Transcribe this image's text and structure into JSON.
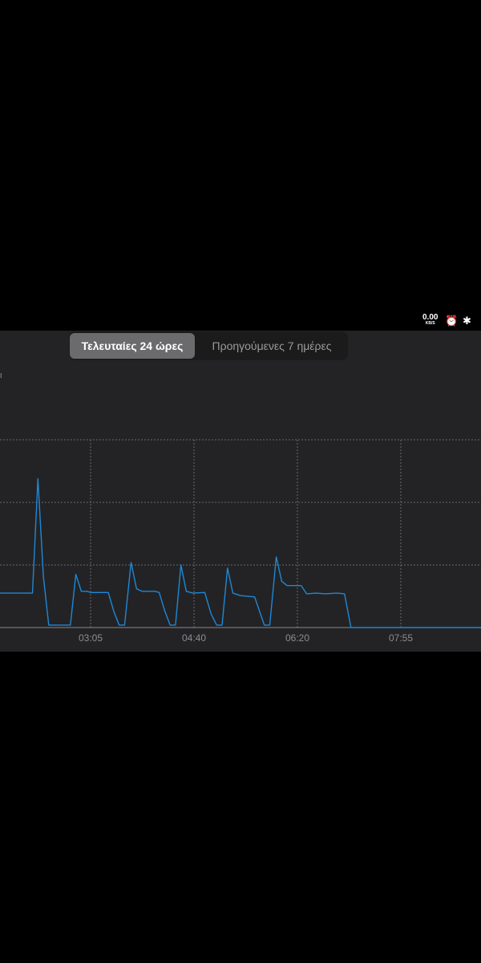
{
  "status_bar": {
    "speed_value": "0.00",
    "speed_unit": "KB/S",
    "icons": [
      "alarm-icon",
      "bluetooth-icon"
    ]
  },
  "segmented": {
    "options": [
      "Τελευταίες 24 ώρες",
      "Προηγούμενες 7 ημέρες"
    ],
    "selected": 0
  },
  "clipped_label": "ι",
  "colors": {
    "line": "#1e88d6",
    "grid": "#6a6a6c",
    "background": "#232325"
  },
  "chart_data": {
    "type": "line",
    "x_ticks": [
      "03:05",
      "04:40",
      "06:20",
      "07:55"
    ],
    "grid": true,
    "ylim": [
      0,
      3
    ],
    "series": [
      {
        "points": [
          [
            "01:41",
            0.55
          ],
          [
            "02:11",
            0.55
          ],
          [
            "02:16",
            2.38
          ],
          [
            "02:21",
            0.82
          ],
          [
            "02:26",
            0.04
          ],
          [
            "02:46",
            0.04
          ],
          [
            "02:51",
            0.85
          ],
          [
            "02:56",
            0.58
          ],
          [
            "03:01",
            0.58
          ],
          [
            "03:05",
            0.56
          ],
          [
            "03:21",
            0.56
          ],
          [
            "03:26",
            0.26
          ],
          [
            "03:31",
            0.04
          ],
          [
            "03:36",
            0.04
          ],
          [
            "03:42",
            1.04
          ],
          [
            "03:47",
            0.62
          ],
          [
            "03:52",
            0.58
          ],
          [
            "04:04",
            0.58
          ],
          [
            "04:08",
            0.56
          ],
          [
            "04:13",
            0.27
          ],
          [
            "04:18",
            0.04
          ],
          [
            "04:23",
            0.04
          ],
          [
            "04:28",
            1.0
          ],
          [
            "04:33",
            0.58
          ],
          [
            "04:39",
            0.55
          ],
          [
            "04:50",
            0.56
          ],
          [
            "04:56",
            0.21
          ],
          [
            "05:01",
            0.04
          ],
          [
            "05:06",
            0.04
          ],
          [
            "05:11",
            0.95
          ],
          [
            "05:16",
            0.55
          ],
          [
            "05:23",
            0.51
          ],
          [
            "05:36",
            0.49
          ],
          [
            "05:40",
            0.29
          ],
          [
            "05:45",
            0.04
          ],
          [
            "05:50",
            0.04
          ],
          [
            "05:56",
            1.13
          ],
          [
            "06:01",
            0.74
          ],
          [
            "06:06",
            0.67
          ],
          [
            "06:10",
            0.67
          ],
          [
            "06:19",
            0.67
          ],
          [
            "06:24",
            0.54
          ],
          [
            "06:33",
            0.55
          ],
          [
            "06:41",
            0.54
          ],
          [
            "06:52",
            0.55
          ],
          [
            "06:59",
            0.54
          ],
          [
            "07:05",
            0
          ],
          [
            "09:05",
            0
          ]
        ]
      }
    ]
  }
}
